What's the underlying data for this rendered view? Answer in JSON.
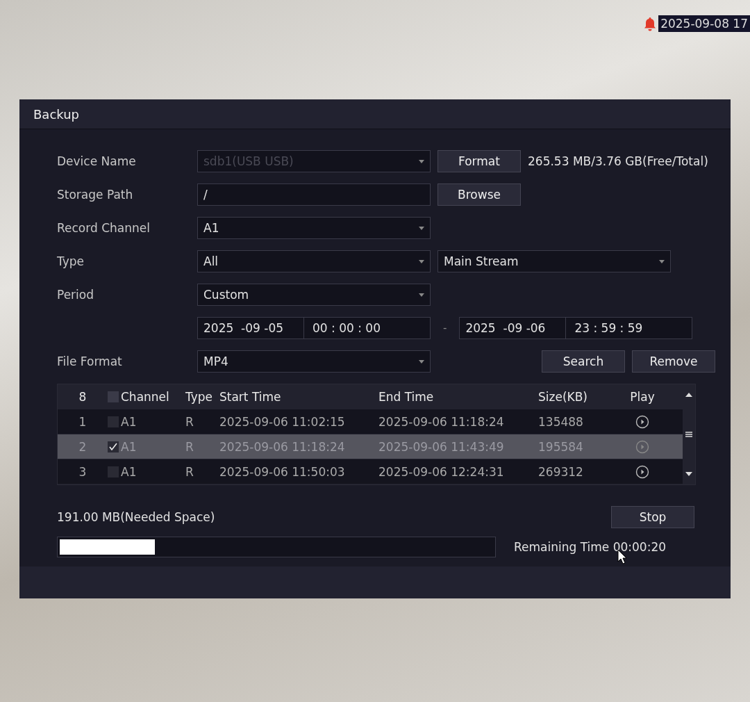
{
  "overlay": {
    "timestamp": "2025-09-08 17"
  },
  "window": {
    "title": "Backup"
  },
  "form": {
    "device_name": {
      "label": "Device Name",
      "value": "sdb1(USB USB)",
      "disabled": true,
      "button": "Format",
      "capacity": "265.53 MB/3.76 GB(Free/Total)"
    },
    "storage_path": {
      "label": "Storage Path",
      "value": "/",
      "button": "Browse"
    },
    "record_channel": {
      "label": "Record Channel",
      "value": "A1"
    },
    "type": {
      "label": "Type",
      "value": "All",
      "stream": "Main Stream"
    },
    "period": {
      "label": "Period",
      "value": "Custom"
    },
    "range": {
      "start_date": "2025  -09 -05",
      "start_time": "00 : 00 : 00",
      "separator": "-",
      "end_date": "2025  -09 -06",
      "end_time": "23 : 59 : 59"
    },
    "file_format": {
      "label": "File Format",
      "value": "MP4"
    },
    "buttons": [
      "Search",
      "Remove"
    ]
  },
  "table": {
    "columns": [
      "8",
      "Channel",
      "Type",
      "Start Time",
      "End Time",
      "Size(KB)",
      "Play"
    ],
    "header_checked": false,
    "rows": [
      {
        "index": "1",
        "checked": false,
        "selected": false,
        "channel": "A1",
        "type": "R",
        "start": "2025-09-06 11:02:15",
        "end": "2025-09-06 11:18:24",
        "size": "135488"
      },
      {
        "index": "2",
        "checked": true,
        "selected": true,
        "channel": "A1",
        "type": "R",
        "start": "2025-09-06 11:18:24",
        "end": "2025-09-06 11:43:49",
        "size": "195584"
      },
      {
        "index": "3",
        "checked": false,
        "selected": false,
        "channel": "A1",
        "type": "R",
        "start": "2025-09-06 11:50:03",
        "end": "2025-09-06 12:24:31",
        "size": "269312"
      }
    ]
  },
  "needed_space": "191.00 MB(Needed Space)",
  "stop_button": "Stop",
  "progress": {
    "level": 0.22,
    "remaining": "Remaining Time 00:00:20"
  }
}
